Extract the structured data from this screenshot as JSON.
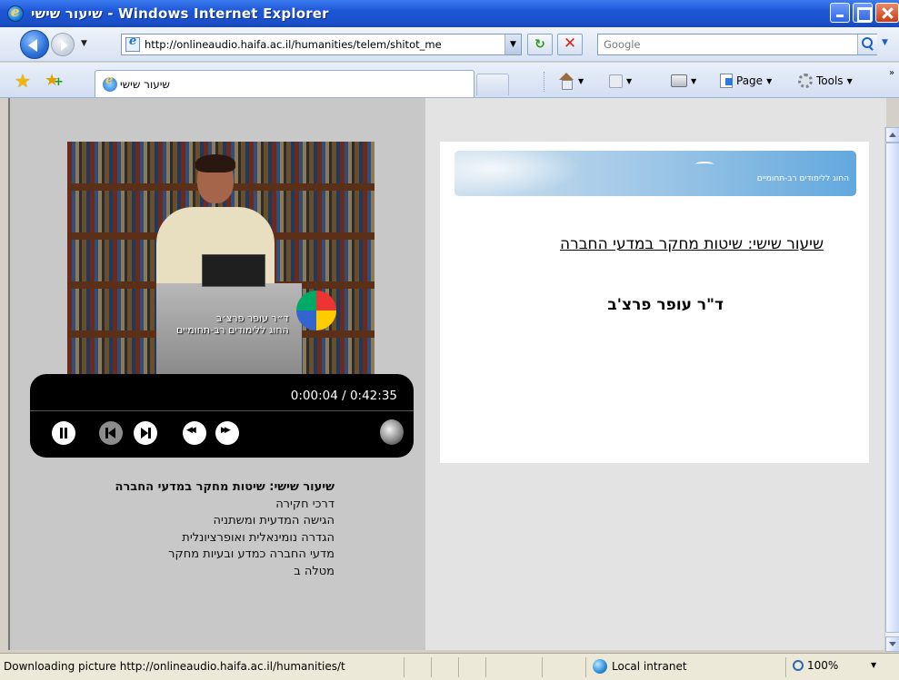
{
  "window": {
    "title": "שיעור שישי - Windows Internet Explorer"
  },
  "address_bar": {
    "url": "http://onlineaudio.haifa.ac.il/humanities/telem/shitot_me"
  },
  "search": {
    "placeholder": "Google"
  },
  "tab": {
    "label": "שיעור שישי"
  },
  "commands": {
    "page": "Page",
    "tools": "Tools"
  },
  "player": {
    "time": "0:00:04 / 0:42:35"
  },
  "video": {
    "caption_line1": "ד״ר עופר פרצ׳ב",
    "caption_line2": "החוג ללימודים רב-תחומיים"
  },
  "toc": {
    "title": "שיעור שישי: שיטות מחקר במדעי החברה",
    "items": [
      "דרכי חקירה",
      "הגישה המדעית ומשתניה",
      "הגדרה נומינאלית ואופרציונלית",
      "מדעי החברה כמדע ובעיות מחקר",
      "מטלה ב"
    ]
  },
  "slide": {
    "banner_text": "החוג ללימודים רב-תחומיים",
    "title": "שיעור שישי: שיטות מחקר במדעי החברה",
    "author": "ד\"ר עופר פרצ'ב"
  },
  "status": {
    "text": "Downloading picture http://onlineaudio.haifa.ac.il/humanities/t",
    "zone": "Local intranet",
    "zoom": "100%"
  }
}
